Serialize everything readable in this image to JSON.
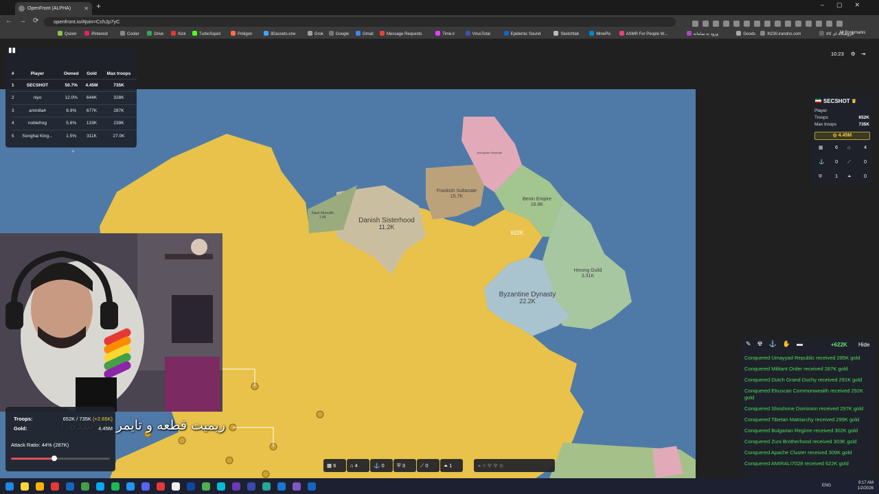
{
  "browser": {
    "tab_title": "OpenFront (ALPHA)",
    "url": "openfront.io/#join=CchJp7yC",
    "bookmarks": [
      "Quixel",
      "Pinterest",
      "Cooler",
      "Drive",
      "Kick",
      "TurboSquid",
      "Poliigon",
      "3Dassets.one",
      "Grok",
      "Google",
      "Gmail",
      "Message Requests",
      "Time.ir",
      "VirusTotal",
      "Epidemic Sound",
      "Sketchfab",
      "MinePic",
      "ASMR For People W...",
      "ورود به سامانه",
      "Goods",
      "lh230.irandns.com",
      "فروشگاه ای کالا"
    ],
    "all_bookmarks": "All Bookmarks"
  },
  "leaderboard": {
    "headers": [
      "#",
      "Player",
      "Owned",
      "Gold",
      "Max troops"
    ],
    "rows": [
      [
        "1",
        "SECSHOT",
        "50.7%",
        "4.45M",
        "735K"
      ],
      [
        "2",
        "niyo",
        "12.0%",
        "644K",
        "328K"
      ],
      [
        "3",
        "amin8a4",
        "8.9%",
        "677K",
        "287K"
      ],
      [
        "4",
        "noblefrog",
        "5.6%",
        "133K",
        "239K"
      ],
      [
        "5",
        "Songhai King...",
        "1.5%",
        "311K",
        "27.0K"
      ]
    ],
    "more": "+"
  },
  "clock": "10:23",
  "player": {
    "name": "SECSHOT",
    "type": "Player",
    "troops_label": "Troops",
    "troops": "652K",
    "max_label": "Max troops",
    "max": "735K",
    "gold": "4.45M",
    "buildings": [
      {
        "icon": "city-icon",
        "value": "6"
      },
      {
        "icon": "factory-icon",
        "value": "4"
      },
      {
        "icon": "port-icon",
        "value": "0"
      },
      {
        "icon": "missile-silo-icon",
        "value": "0"
      },
      {
        "icon": "defense-post-icon",
        "value": "1"
      },
      {
        "icon": "sam-launcher-icon",
        "value": "0"
      }
    ]
  },
  "feed": {
    "gain": "+622K",
    "hide": "Hide",
    "messages": [
      "Conquered Umayyad Republic received 285K gold",
      "Conquered Militant Order received 287K gold",
      "Conquered Dutch Grand Duchy received 291K gold",
      "Conquered Etruscan Commonwealth received 292K gold",
      "Conquered Shoshone Dominion received 297K gold",
      "Conquered Tibetan Matriarchy received 299K gold",
      "Conquered Bulgarian Regime received 302K gold",
      "Conquered Zuni Brotherhood received 303K gold",
      "Conquered Apache Cluster received 309K gold",
      "Conquered AMIRALI7028 received 622K gold"
    ]
  },
  "controls": {
    "troops_label": "Troops:",
    "troops_value": "652K / 735K",
    "troops_delta": "(+2.65K)",
    "gold_label": "Gold:",
    "gold_value": "4.45M",
    "attack_ratio": "Attack Ratio: 44% (287K)",
    "attack_ratio_fraction": 0.44
  },
  "buildbar": [
    {
      "icon": "city-icon",
      "value": "6"
    },
    {
      "icon": "factory-icon",
      "value": "4"
    },
    {
      "icon": "port-icon",
      "value": "0"
    },
    {
      "icon": "shield-icon",
      "value": "3"
    },
    {
      "icon": "missile-silo-icon",
      "value": "0"
    },
    {
      "icon": "sam-icon",
      "value": "1"
    }
  ],
  "map_labels": [
    {
      "name": "Danish Sisterhood",
      "value": "11.2K"
    },
    {
      "name": "Frankish Sultanate",
      "value": "15.7K"
    },
    {
      "name": "Benin Empire",
      "value": "16.8K"
    },
    {
      "name": "Hmong Guild",
      "value": "3.31K"
    },
    {
      "name": "Byzantine Dynasty",
      "value": "22.2K"
    },
    {
      "name": "Nasir Monolith",
      "value": "1.4K"
    },
    {
      "name": "Mongolian Sultanate",
      "value": ""
    }
  ],
  "player_troops_on_map": "622K",
  "caption": "ریمیت قطعه و تایمر پاز شده !",
  "taskbar": {
    "lang": "ENG",
    "time": "9:17 AM",
    "date": "1/2/2026"
  },
  "colors": {
    "ocean": "#4f7aa8",
    "player_territory": "#e8c24a",
    "feed_text": "#4cde5a"
  }
}
